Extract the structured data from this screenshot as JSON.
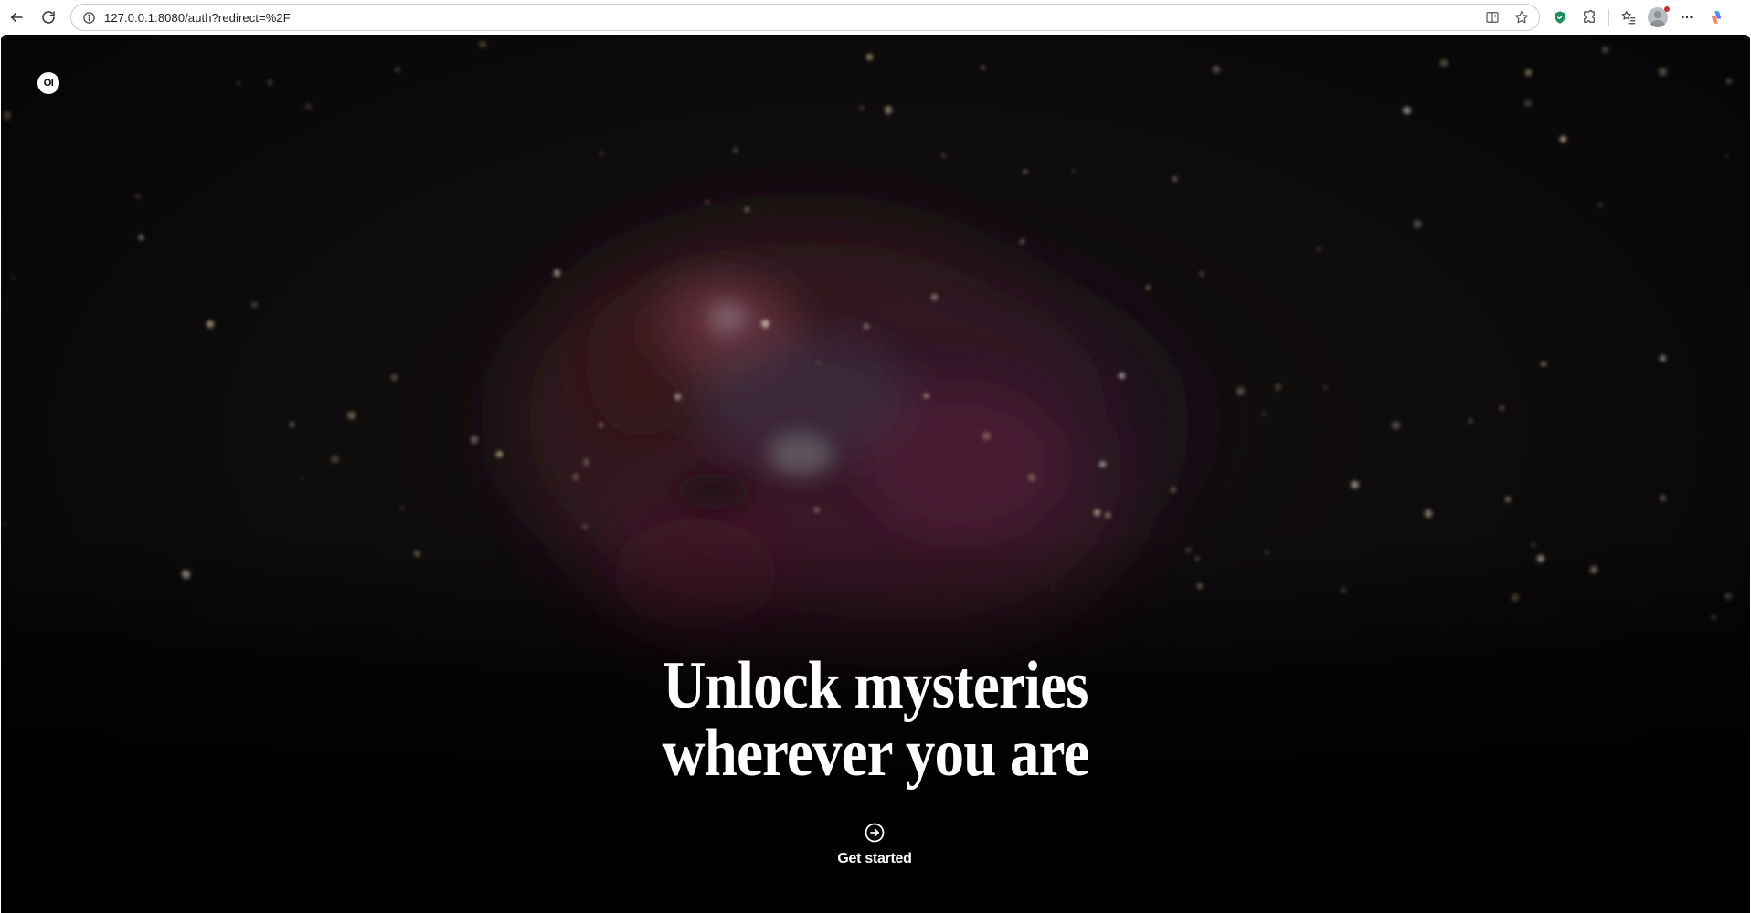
{
  "browser": {
    "url": "127.0.0.1:8080/auth?redirect=%2F"
  },
  "page": {
    "logo_text": "OI",
    "headline_line1": "Unlock mysteries",
    "headline_line2": "wherever you are",
    "cta_label": "Get started"
  },
  "icons": {
    "back": "arrow-left-icon",
    "reload": "reload-icon",
    "site_info": "info-circle-icon",
    "split_screen": "split-screen-icon",
    "favorite": "star-icon",
    "security_extension": "shield-icon",
    "extensions": "puzzle-icon",
    "favorites": "favorites-list-icon",
    "profile": "profile-avatar",
    "more": "more-dots-icon",
    "copilot": "copilot-icon",
    "cta": "arrow-right-circle-icon"
  },
  "colors": {
    "page_background": "#040404",
    "text": "#ffffff",
    "shield": "#1a8f5c"
  }
}
